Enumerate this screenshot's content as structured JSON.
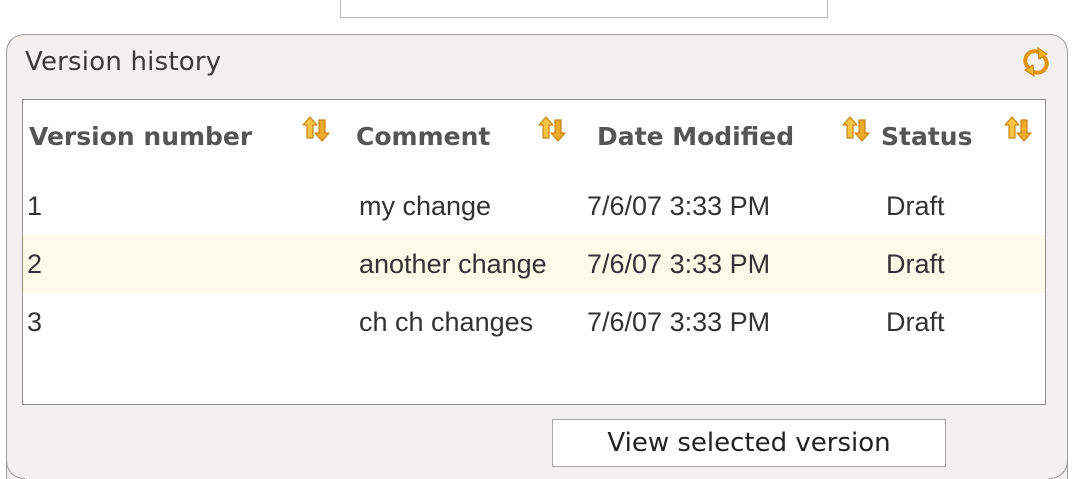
{
  "panel": {
    "title": "Version history",
    "refresh_icon": "refresh-icon"
  },
  "table": {
    "columns": [
      {
        "label": "Version number",
        "icon": "sort-icon"
      },
      {
        "label": "Comment",
        "icon": "sort-icon"
      },
      {
        "label": "Date Modified",
        "icon": "sort-icon"
      },
      {
        "label": "Status",
        "icon": "sort-icon"
      }
    ],
    "rows": [
      {
        "version": "1",
        "comment": "my change",
        "date": "7/6/07 3:33 PM",
        "status": "Draft"
      },
      {
        "version": "2",
        "comment": "another change",
        "date": "7/6/07 3:33 PM",
        "status": "Draft"
      },
      {
        "version": "3",
        "comment": "ch ch changes",
        "date": "7/6/07 3:33 PM",
        "status": "Draft"
      }
    ]
  },
  "actions": {
    "view_selected_label": "View selected version"
  },
  "colors": {
    "alt_row": "#fcfbea",
    "icon_orange": "#f0a418"
  }
}
